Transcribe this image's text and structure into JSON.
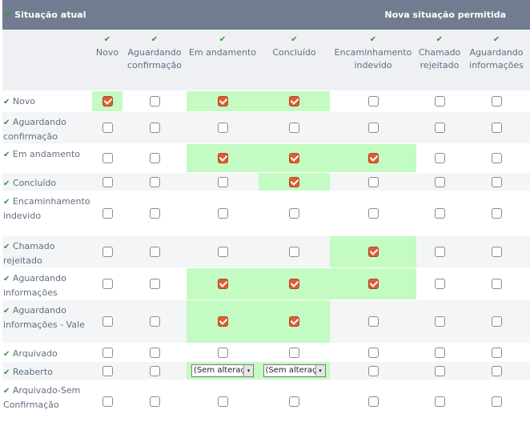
{
  "header": {
    "left_title": "Situação atual",
    "right_title": "Nova situação permitida"
  },
  "columns": [
    "Novo",
    "Aguardando confirmação",
    "Em andamento",
    "Concluído",
    "Encaminhamento indevido",
    "Chamado rejeitado",
    "Aguardando informações"
  ],
  "rows": [
    {
      "label": "Novo",
      "cells": [
        "hl-checked",
        "none",
        "hl-checked",
        "hl-checked",
        "none",
        "none",
        "none"
      ]
    },
    {
      "label": "Aguardando confirmação",
      "cells": [
        "none",
        "none",
        "none",
        "none",
        "none",
        "none",
        "none"
      ]
    },
    {
      "label": "Em andamento",
      "cells": [
        "none",
        "none",
        "hl-checked",
        "hl-checked",
        "hl-checked",
        "none",
        "none"
      ]
    },
    {
      "label": "Concluído",
      "cells": [
        "none",
        "none",
        "none",
        "hl-checked",
        "none",
        "none",
        "none"
      ]
    },
    {
      "label": "Encaminhamento indevido",
      "cells": [
        "none",
        "none",
        "none",
        "none",
        "none",
        "none",
        "none"
      ]
    },
    {
      "label": "Chamado rejeitado",
      "cells": [
        "none",
        "none",
        "none",
        "none",
        "hl-checked",
        "none",
        "none"
      ]
    },
    {
      "label": "Aguardando informações",
      "cells": [
        "none",
        "none",
        "hl-checked",
        "hl-checked",
        "hl-checked",
        "none",
        "none"
      ]
    },
    {
      "label": "Aguardando informações - Vale",
      "cells": [
        "none",
        "none",
        "hl-checked",
        "hl-checked",
        "none",
        "none",
        "none"
      ]
    },
    {
      "label": "Arquivado",
      "cells": [
        "none",
        "none",
        "none",
        "none",
        "none",
        "none",
        "none"
      ]
    },
    {
      "label": "Reaberto",
      "cells": [
        "none",
        "none",
        "hl-select",
        "hl-select",
        "none",
        "none",
        "none"
      ]
    },
    {
      "label": "Arquivado-Sem Confirmação",
      "cells": [
        "none",
        "none",
        "none",
        "none",
        "none",
        "none",
        "none"
      ]
    }
  ],
  "select": {
    "value": "(Sem alteraç",
    "arrow": "▾"
  },
  "icons": {
    "check": "✔"
  },
  "colors": {
    "header_bg": "#717c90",
    "highlight": "#c3fbc3",
    "checked": "#dd5e33",
    "check_icon": "#2e9a2e"
  }
}
